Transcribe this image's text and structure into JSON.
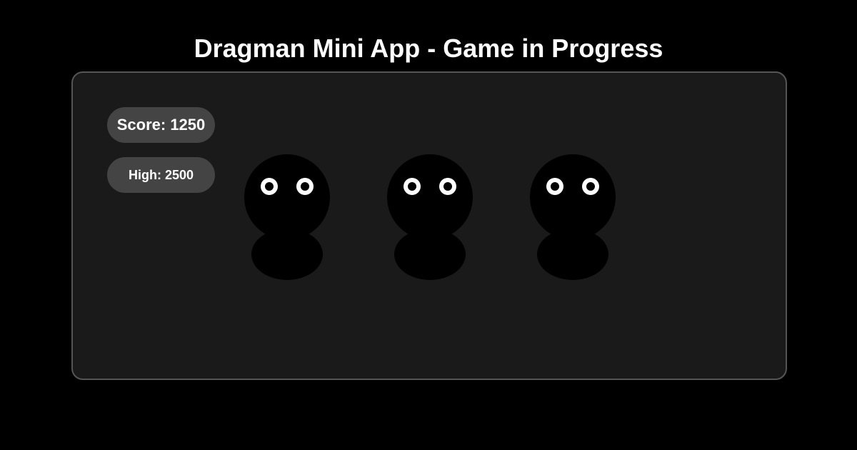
{
  "title": "Dragman Mini App - Game in Progress",
  "hud": {
    "score_label": "Score: 1250",
    "high_label": "High: 2500"
  },
  "characters": [
    {
      "name": "dragman-1"
    },
    {
      "name": "dragman-2"
    },
    {
      "name": "dragman-3"
    }
  ],
  "colors": {
    "background": "#000000",
    "panel": "#1a1a1a",
    "panel_border": "#555555",
    "pill": "#444444",
    "text": "#ffffff",
    "character": "#000000",
    "eye": "#ffffff"
  }
}
